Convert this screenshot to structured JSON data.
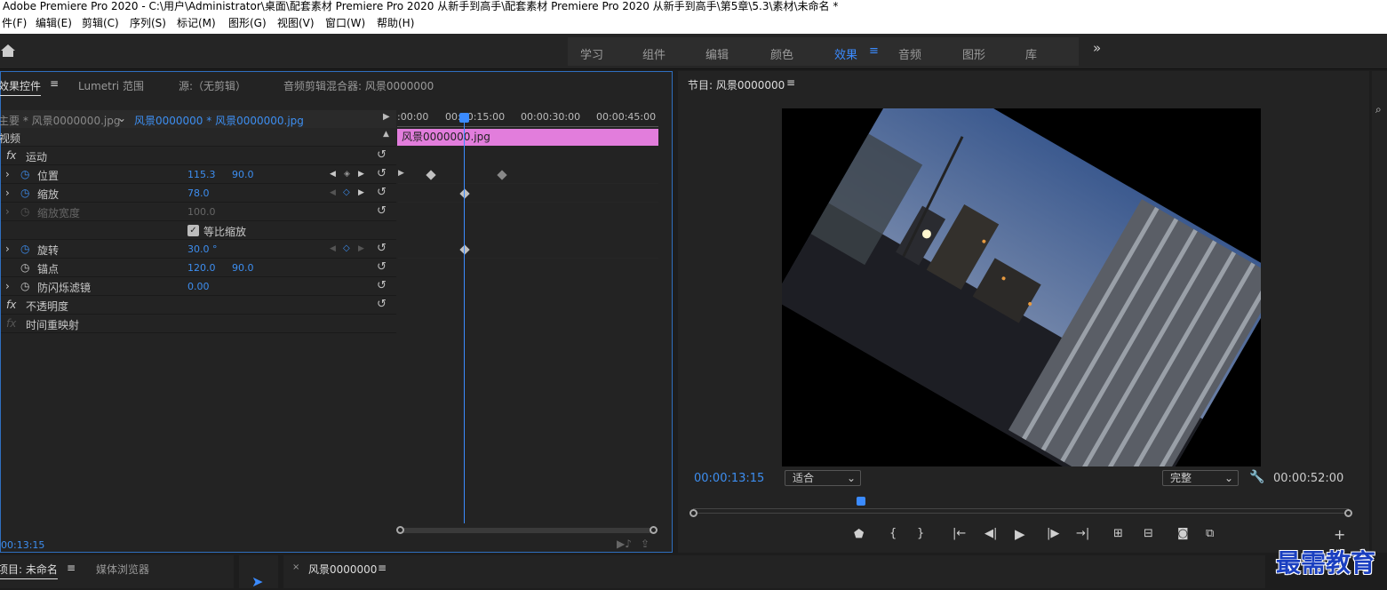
{
  "window": {
    "title": "Adobe Premiere Pro 2020 - C:\\用户\\Administrator\\桌面\\配套素材 Premiere Pro 2020 从新手到高手\\配套素材 Premiere Pro 2020 从新手到高手\\第5章\\5.3\\素材\\未命名 *"
  },
  "menu": [
    "件(F)",
    "编辑(E)",
    "剪辑(C)",
    "序列(S)",
    "标记(M)",
    "图形(G)",
    "视图(V)",
    "窗口(W)",
    "帮助(H)"
  ],
  "workspaces": {
    "tabs": [
      "学习",
      "组件",
      "编辑",
      "颜色",
      "效果",
      "音频",
      "图形",
      "库"
    ],
    "active": "效果",
    "more": "»"
  },
  "effect_controls": {
    "tabs": [
      "效果控件",
      "Lumetri 范围",
      "源:（无剪辑）",
      "音频剪辑混合器: 风景0000000"
    ],
    "active_tab": "效果控件",
    "master": "主要 * 风景0000000.jpg",
    "clip": "风景0000000 * 风景0000000.jpg",
    "ruler": [
      ":00:00",
      "00:00:15:00",
      "00:00:30:00",
      "00:00:45:00"
    ],
    "clip_bar_label": "风景0000000.jpg",
    "section_video": "视频",
    "motion": "运动",
    "properties": [
      {
        "name": "位置",
        "v1": "115.3",
        "v2": "90.0"
      },
      {
        "name": "缩放",
        "v1": "78.0",
        "v2": ""
      },
      {
        "name": "缩放宽度",
        "v1": "100.0",
        "v2": ""
      },
      {
        "name": "旋转",
        "v1": "30.0 °",
        "v2": ""
      },
      {
        "name": "锚点",
        "v1": "120.0",
        "v2": "90.0"
      },
      {
        "name": "防闪烁滤镜",
        "v1": "0.00",
        "v2": ""
      }
    ],
    "uniform_scale": "等比缩放",
    "opacity": "不透明度",
    "time_remap": "时间重映射",
    "timecode": "00:13:15"
  },
  "program_monitor": {
    "title": "节目: 风景0000000",
    "timecode": "00:00:13:15",
    "fit": "适合",
    "quality": "完整",
    "duration": "00:00:52:00"
  },
  "bottom": {
    "project_tab": "项目: 未命名",
    "media_browser": "媒体浏览器",
    "sequence_tab": "风景0000000"
  },
  "watermark": "最需教育",
  "colors": {
    "accent": "#3b8bff",
    "clip_bar": "#e27ddc",
    "value": "#3d8ef0"
  }
}
